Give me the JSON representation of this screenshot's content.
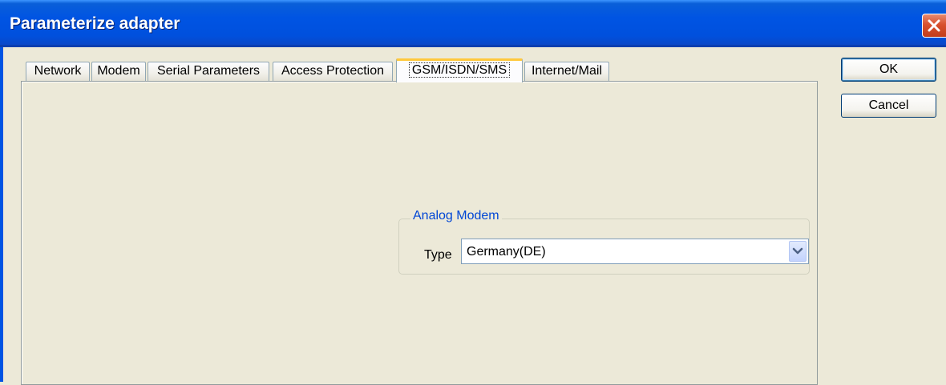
{
  "window": {
    "title": "Parameterize adapter"
  },
  "tabs": [
    {
      "label": "Network",
      "active": false
    },
    {
      "label": "Modem",
      "active": false
    },
    {
      "label": "Serial Parameters",
      "active": false
    },
    {
      "label": "Access Protection",
      "active": false
    },
    {
      "label": "GSM/ISDN/SMS",
      "active": true
    },
    {
      "label": "Internet/Mail",
      "active": false
    }
  ],
  "panel": {
    "group": {
      "title": "Analog Modem",
      "type_label": "Type",
      "type_value": "Germany(DE)"
    }
  },
  "buttons": {
    "ok": "OK",
    "cancel": "Cancel"
  },
  "colors": {
    "titlebar": "#0054e3",
    "group_title": "#0046d5",
    "active_tab_accent": "#ffc83c",
    "close_button": "#d8512e"
  }
}
